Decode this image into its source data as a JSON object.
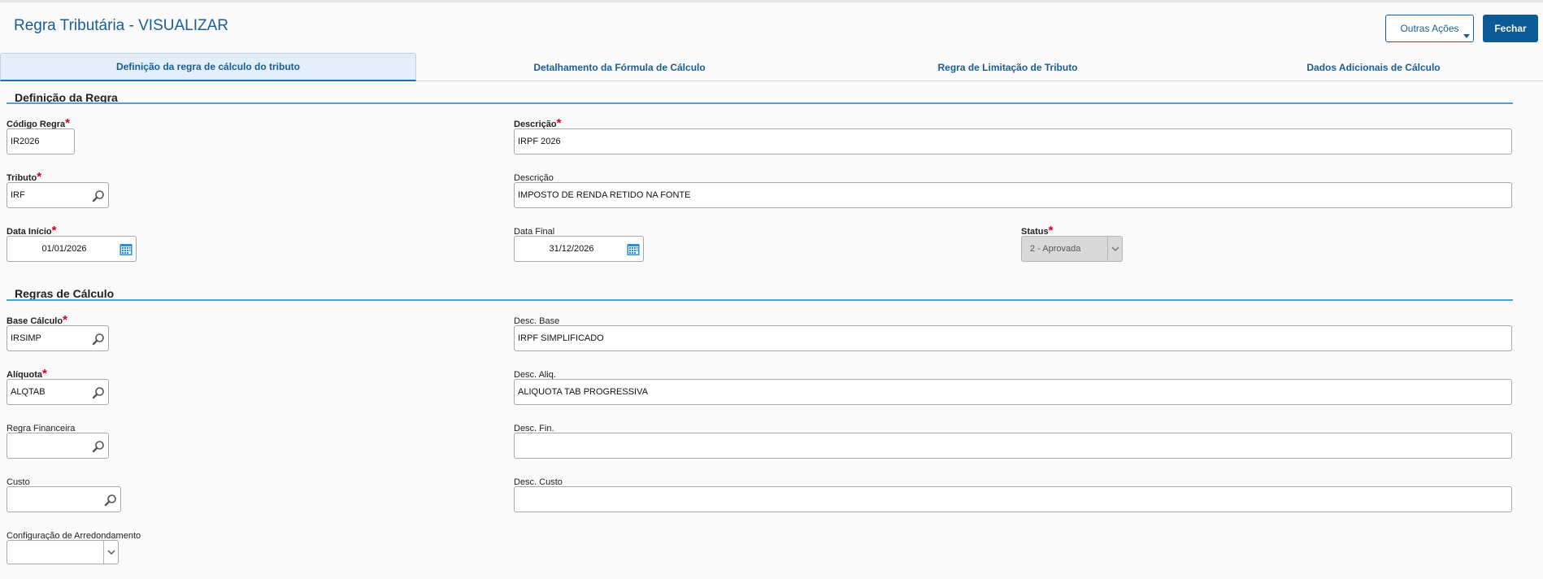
{
  "header": {
    "title": "Regra Tributária - VISUALIZAR",
    "outras_acoes": "Outras Ações",
    "fechar": "Fechar"
  },
  "tabs": [
    {
      "label": "Definição da regra de cálculo do tributo"
    },
    {
      "label": "Detalhamento da Fórmula de Cálculo"
    },
    {
      "label": "Regra de Limitação de Tributo"
    },
    {
      "label": "Dados Adicionais de Cálculo"
    }
  ],
  "sections": {
    "definicao": "Definição da Regra",
    "calculo": "Regras de Cálculo"
  },
  "fields": {
    "codigo_regra": {
      "label": "Código Regra",
      "value": "IR2026"
    },
    "descricao": {
      "label": "Descrição",
      "value": "IRPF 2026"
    },
    "tributo": {
      "label": "Tributo",
      "value": "IRF"
    },
    "descricao_tributo": {
      "label": "Descrição",
      "value": "IMPOSTO DE RENDA RETIDO NA FONTE"
    },
    "data_inicio": {
      "label": "Data Início",
      "value": "01/01/2026"
    },
    "data_final": {
      "label": "Data Final",
      "value": "31/12/2026"
    },
    "status": {
      "label": "Status",
      "value": "2 - Aprovada"
    },
    "base_calculo": {
      "label": "Base Cálculo",
      "value": "IRSIMP"
    },
    "desc_base": {
      "label": "Desc. Base",
      "value": "IRPF SIMPLIFICADO"
    },
    "aliquota": {
      "label": "Alíquota",
      "value": "ALQTAB"
    },
    "desc_aliq": {
      "label": "Desc. Aliq.",
      "value": "ALIQUOTA TAB PROGRESSIVA"
    },
    "regra_financeira": {
      "label": "Regra Financeira",
      "value": ""
    },
    "desc_fin": {
      "label": "Desc. Fin.",
      "value": ""
    },
    "custo": {
      "label": "Custo",
      "value": ""
    },
    "desc_custo": {
      "label": "Desc. Custo",
      "value": ""
    },
    "config_arredondamento": {
      "label": "Configuração de Arredondamento",
      "value": ""
    }
  },
  "required_mark": "*",
  "colors": {
    "accent": "#1a5d96",
    "section_line": "#4aa3d8",
    "required": "#d0021b"
  },
  "icons": {
    "lookup": "magnifier-icon",
    "calendar": "calendar-icon",
    "dropdown": "chevron-down-icon"
  }
}
